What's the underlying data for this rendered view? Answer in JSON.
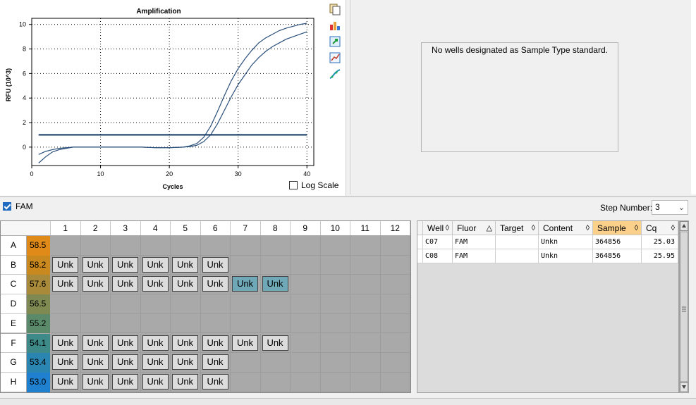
{
  "chart_data": {
    "type": "line",
    "title": "Amplification",
    "xlabel": "Cycles",
    "ylabel": "RFU (10^3)",
    "xlim": [
      0,
      41
    ],
    "ylim": [
      -1.5,
      10.5
    ],
    "xticks": [
      0,
      10,
      20,
      30,
      40
    ],
    "yticks": [
      0,
      2,
      4,
      6,
      8,
      10
    ],
    "grid": true,
    "threshold": 1.0,
    "series": [
      {
        "x": [
          1,
          2,
          3,
          4,
          5,
          6,
          8,
          10,
          12,
          14,
          16,
          18,
          20,
          22,
          23,
          24,
          25,
          26,
          27,
          28,
          29,
          30,
          31,
          32,
          33,
          34,
          35,
          36,
          37,
          38,
          39,
          40
        ],
        "values": [
          -0.6,
          -0.35,
          -0.2,
          -0.1,
          -0.05,
          0,
          0,
          0,
          0,
          0,
          0,
          -0.05,
          -0.05,
          0,
          0.1,
          0.3,
          0.8,
          1.7,
          2.9,
          4.2,
          5.4,
          6.4,
          7.2,
          7.9,
          8.5,
          8.9,
          9.2,
          9.5,
          9.7,
          9.85,
          10.0,
          10.1
        ]
      },
      {
        "x": [
          1,
          2,
          3,
          4,
          5,
          6,
          8,
          10,
          12,
          14,
          16,
          18,
          20,
          22,
          23,
          24,
          25,
          26,
          27,
          28,
          29,
          30,
          31,
          32,
          33,
          34,
          35,
          36,
          37,
          38,
          39,
          40
        ],
        "values": [
          -1.3,
          -0.8,
          -0.4,
          -0.2,
          -0.1,
          0,
          0,
          0,
          0,
          0,
          0,
          -0.05,
          -0.05,
          0,
          0.05,
          0.15,
          0.45,
          1.0,
          1.9,
          3.0,
          4.1,
          5.1,
          5.9,
          6.7,
          7.3,
          7.8,
          8.2,
          8.5,
          8.8,
          9.0,
          9.2,
          9.4
        ]
      }
    ]
  },
  "chart_colors": {
    "curve": "#2a4f7a",
    "threshold": "#1b3f6b",
    "grid": "#000000"
  },
  "toolbar_icons": [
    "copy-icon",
    "chart-settings-icon",
    "export-icon",
    "zoom-icon",
    "curve-icon"
  ],
  "log_scale_label": "Log Scale",
  "std_message": "No wells designated as Sample Type standard.",
  "fluor_checkbox_label": "FAM",
  "step_number": {
    "label": "Step Number:",
    "value": "3"
  },
  "plate": {
    "columns": [
      "1",
      "2",
      "3",
      "4",
      "5",
      "6",
      "7",
      "8",
      "9",
      "10",
      "11",
      "12"
    ],
    "rows": [
      {
        "label": "A",
        "temp": "58.5",
        "color": "#e08a1a",
        "wells": [
          "",
          "",
          "",
          "",
          "",
          "",
          "",
          "",
          "",
          "",
          "",
          ""
        ]
      },
      {
        "label": "B",
        "temp": "58.2",
        "color": "#c9891e",
        "wells": [
          "Unk",
          "Unk",
          "Unk",
          "Unk",
          "Unk",
          "Unk",
          "",
          "",
          "",
          "",
          "",
          ""
        ]
      },
      {
        "label": "C",
        "temp": "57.6",
        "color": "#a88a3a",
        "wells": [
          "Unk",
          "Unk",
          "Unk",
          "Unk",
          "Unk",
          "Unk",
          "Unk",
          "Unk",
          "",
          "",
          "",
          ""
        ]
      },
      {
        "label": "D",
        "temp": "56.5",
        "color": "#7f8a52",
        "wells": [
          "",
          "",
          "",
          "",
          "",
          "",
          "",
          "",
          "",
          "",
          "",
          ""
        ]
      },
      {
        "label": "E",
        "temp": "55.2",
        "color": "#5a8a6a",
        "wells": [
          "",
          "",
          "",
          "",
          "",
          "",
          "",
          "",
          "",
          "",
          "",
          ""
        ]
      },
      {
        "label": "F",
        "temp": "54.1",
        "color": "#3d8a88",
        "wells": [
          "Unk",
          "Unk",
          "Unk",
          "Unk",
          "Unk",
          "Unk",
          "Unk",
          "Unk",
          "",
          "",
          "",
          ""
        ]
      },
      {
        "label": "G",
        "temp": "53.4",
        "color": "#2a86b0",
        "wells": [
          "Unk",
          "Unk",
          "Unk",
          "Unk",
          "Unk",
          "Unk",
          "",
          "",
          "",
          "",
          "",
          ""
        ]
      },
      {
        "label": "H",
        "temp": "53.0",
        "color": "#1f80d0",
        "wells": [
          "Unk",
          "Unk",
          "Unk",
          "Unk",
          "Unk",
          "Unk",
          "",
          "",
          "",
          "",
          "",
          ""
        ]
      }
    ],
    "selected_wells": [
      "C7",
      "C8"
    ]
  },
  "table": {
    "columns": [
      {
        "label": "Well",
        "sort_icon": "◊"
      },
      {
        "label": "Fluor",
        "sort_icon": "△"
      },
      {
        "label": "Target",
        "sort_icon": "◊"
      },
      {
        "label": "Content",
        "sort_icon": "◊"
      },
      {
        "label": "Sample",
        "sort_icon": "◊"
      },
      {
        "label": "Cq",
        "sort_icon": "◊"
      }
    ],
    "rows": [
      [
        "C07",
        "FAM",
        "",
        "Unkn",
        "364856",
        "25.03"
      ],
      [
        "C08",
        "FAM",
        "",
        "Unkn",
        "364856",
        "25.95"
      ]
    ]
  }
}
